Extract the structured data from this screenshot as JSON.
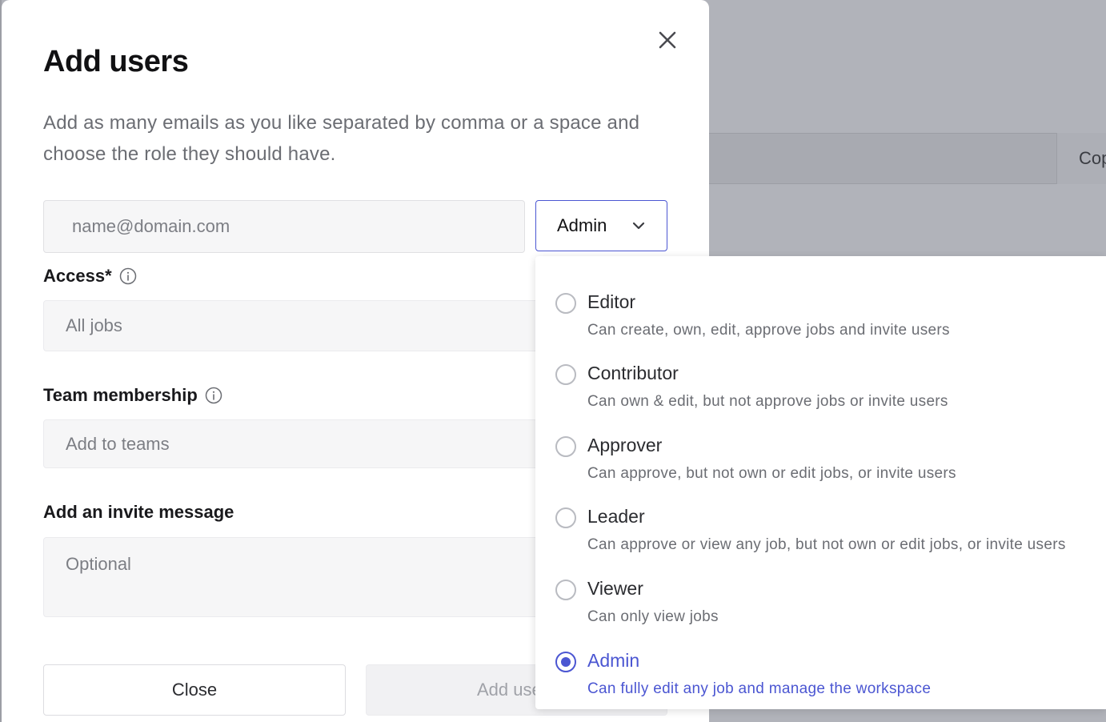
{
  "background": {
    "copy_button_label": "Cop"
  },
  "modal": {
    "title": "Add users",
    "description": "Add as many emails as you like separated by comma or a space and choose the role they should have.",
    "email_placeholder": "name@domain.com",
    "role_select": {
      "value": "Admin"
    },
    "access": {
      "label": "Access*",
      "value": "All jobs"
    },
    "team": {
      "label": "Team membership",
      "placeholder": "Add to teams"
    },
    "invite": {
      "label": "Add an invite message",
      "placeholder": "Optional"
    },
    "buttons": {
      "close": "Close",
      "add": "Add users"
    },
    "icons": {
      "close": "close-icon",
      "info": "info-icon",
      "chevron": "chevron-down-icon"
    }
  },
  "dropdown": {
    "options": [
      {
        "title": "Editor",
        "desc": "Can create, own, edit, approve jobs and invite users",
        "selected": false
      },
      {
        "title": "Contributor",
        "desc": "Can own & edit, but not approve jobs or invite users",
        "selected": false
      },
      {
        "title": "Approver",
        "desc": "Can approve, but not own or edit jobs, or invite users",
        "selected": false
      },
      {
        "title": "Leader",
        "desc": "Can approve or view any job, but not own or edit jobs, or invite users",
        "selected": false
      },
      {
        "title": "Viewer",
        "desc": "Can only view jobs",
        "selected": false
      },
      {
        "title": "Admin",
        "desc": "Can fully edit any job and manage the workspace",
        "selected": true
      }
    ]
  },
  "colors": {
    "accent": "#4b56d2",
    "overlay": "#b1b3ba"
  }
}
